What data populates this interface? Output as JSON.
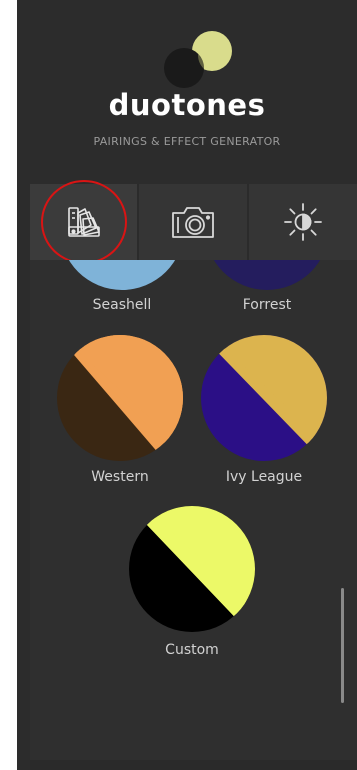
{
  "app": {
    "title": "duotones",
    "subtitle": "PAIRINGS & EFFECT GENERATOR"
  },
  "logo": {
    "circle_light_color": "#d9dc8c",
    "circle_dark_color": "#1a1a1a"
  },
  "tabs": [
    {
      "icon": "color-swatch-fan-icon",
      "active": true
    },
    {
      "icon": "camera-icon",
      "active": false
    },
    {
      "icon": "brightness-sun-icon",
      "active": false
    }
  ],
  "annotation": {
    "color": "#d91414"
  },
  "swatches": [
    {
      "label": "Seashell",
      "color_top": "#7fb3d8",
      "color_bottom": "#7fb3d8"
    },
    {
      "label": "Forrest",
      "color_top": "#241d5e",
      "color_bottom": "#241d5e"
    },
    {
      "label": "Western",
      "color_top": "#f1a053",
      "color_bottom": "#3a2713"
    },
    {
      "label": "Ivy League",
      "color_top": "#dcb44e",
      "color_bottom": "#2b0f86"
    },
    {
      "label": "Custom",
      "color_top": "#ecf968",
      "color_bottom": "#000000"
    }
  ]
}
